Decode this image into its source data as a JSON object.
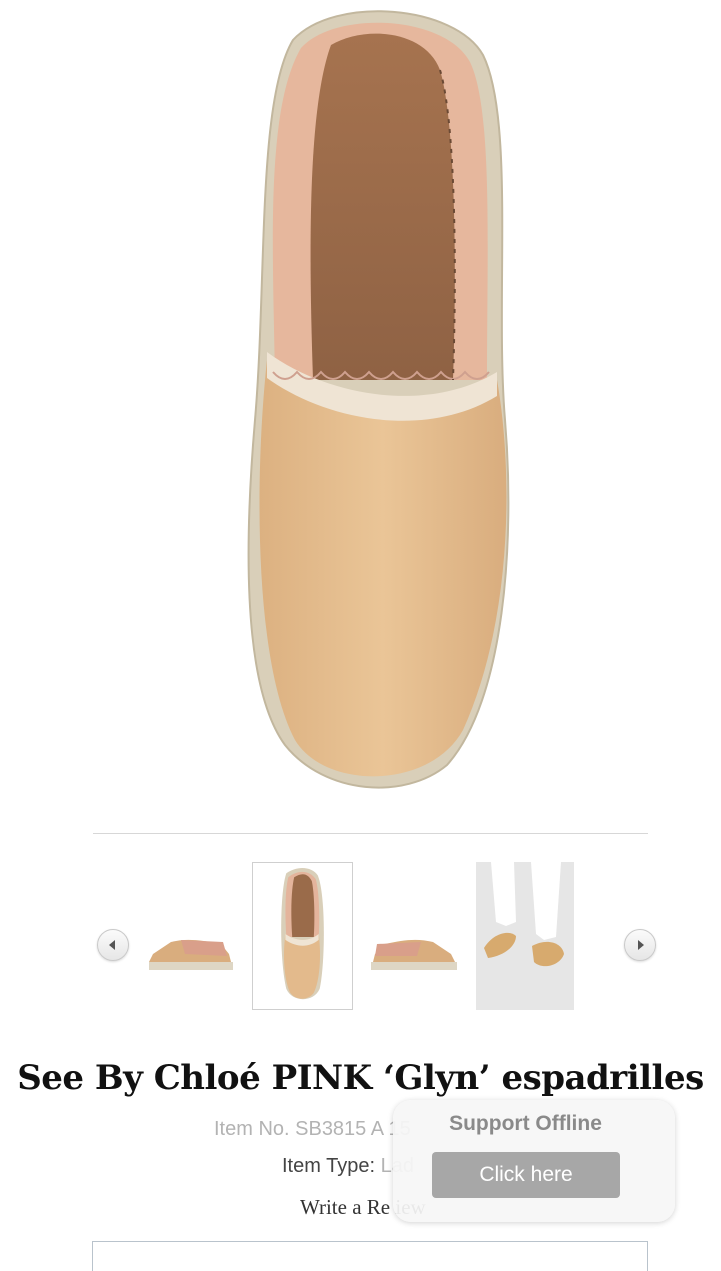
{
  "product": {
    "title": "See By Chloé PINK ‘Glyn’ espadrilles",
    "item_no": "Item No. SB3815 A 15",
    "item_type_label": "Item Type: ",
    "item_type_value": "Lad",
    "review_link": "Write a Re iew"
  },
  "gallery": {
    "thumbnails": [
      {
        "view": "side-left"
      },
      {
        "view": "top",
        "selected": true
      },
      {
        "view": "side-right"
      },
      {
        "view": "worn"
      }
    ]
  },
  "support_widget": {
    "title": "Support Offline",
    "button_label": "Click here"
  },
  "icons": {
    "prev": "chevron-left-icon",
    "next": "chevron-right-icon"
  },
  "colors": {
    "upper": "#e8c193",
    "lining": "#e4b49c",
    "insole": "#a87a59",
    "jute": "#dcd3bf",
    "support_button": "#a7a7a7"
  }
}
